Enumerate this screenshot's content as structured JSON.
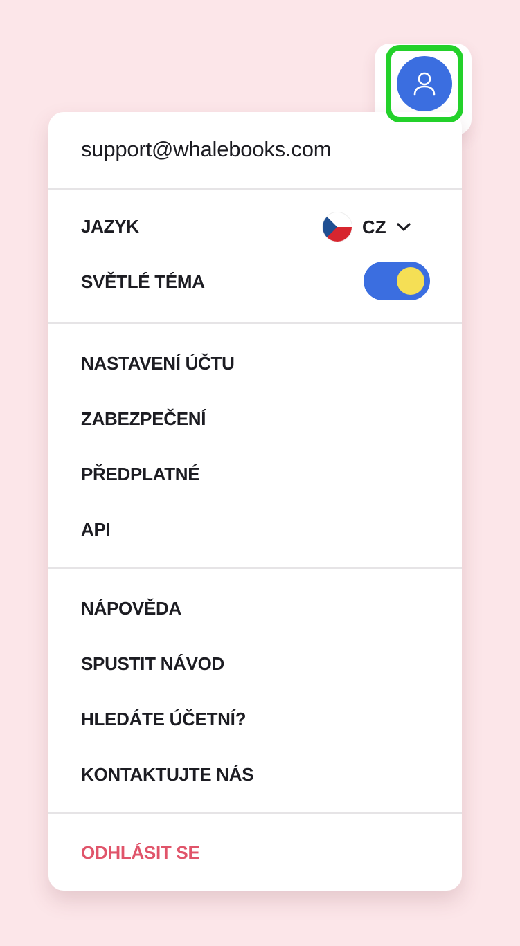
{
  "account": {
    "email": "support@whalebooks.com"
  },
  "avatar": {
    "icon": "user-icon",
    "color": "#3b6ee0",
    "highlight_color": "#23d12a"
  },
  "preferences": {
    "language_label": "JAZYK",
    "language_code": "CZ",
    "language_flag": "czech-flag-icon",
    "theme_label": "SVĚTLÉ TÉMA",
    "theme_toggle_on": true,
    "toggle_track_color": "#3b6ee0",
    "toggle_knob_color": "#f5df55"
  },
  "account_menu": [
    "NASTAVENÍ ÚČTU",
    "ZABEZPEČENÍ",
    "PŘEDPLATNÉ",
    "API"
  ],
  "help_menu": [
    "NÁPOVĚDA",
    "SPUSTIT NÁVOD",
    "HLEDÁTE ÚČETNÍ?",
    "KONTAKTUJTE NÁS"
  ],
  "logout_label": "ODHLÁSIT SE",
  "colors": {
    "background": "#fce6e9",
    "logout": "#e0546a"
  }
}
